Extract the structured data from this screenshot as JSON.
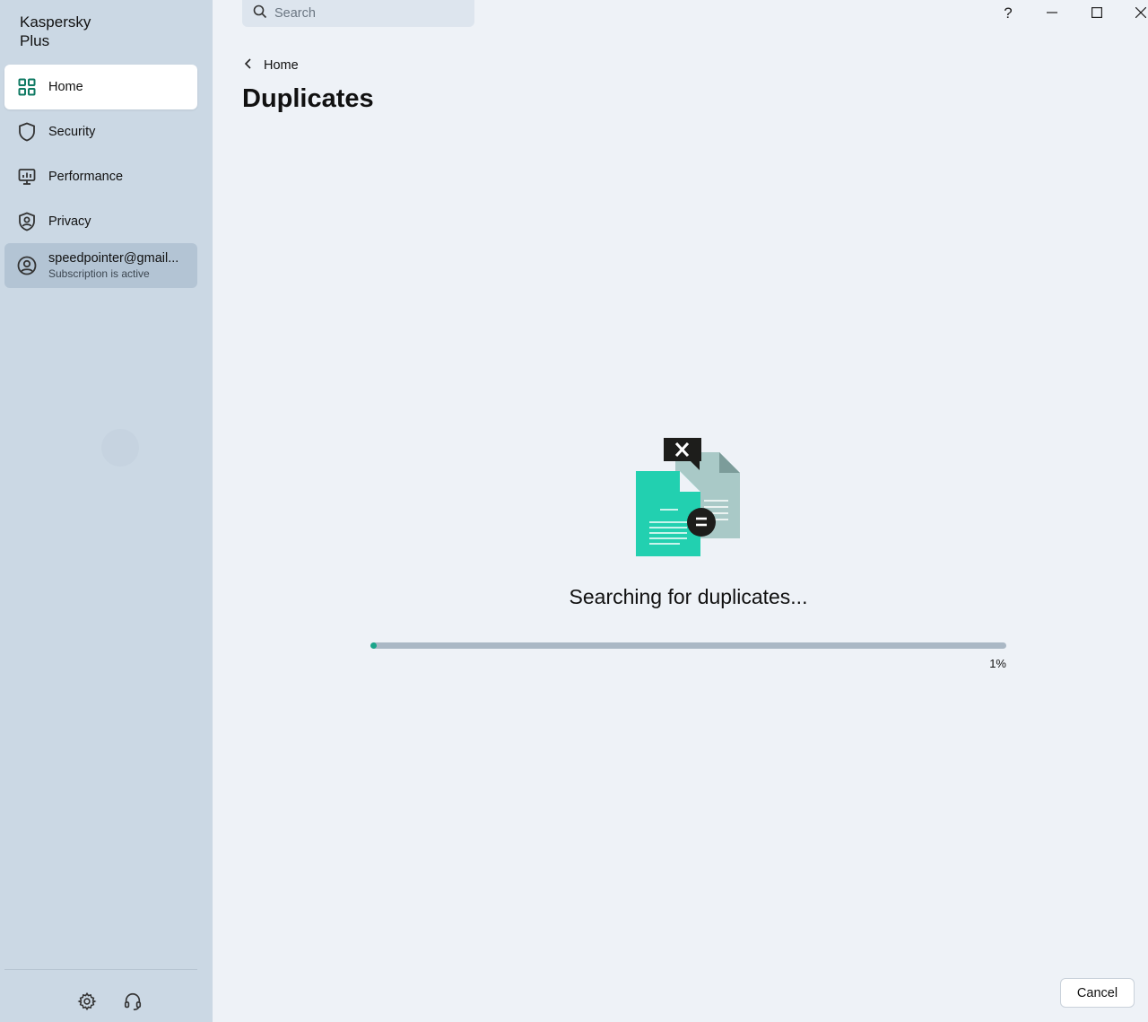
{
  "app": {
    "title_line1": "Kaspersky",
    "title_line2": "Plus"
  },
  "sidebar": {
    "items": [
      {
        "label": "Home",
        "icon": "dashboard-icon",
        "active": true
      },
      {
        "label": "Security",
        "icon": "shield-icon"
      },
      {
        "label": "Performance",
        "icon": "monitor-icon"
      },
      {
        "label": "Privacy",
        "icon": "privacy-shield-icon"
      }
    ],
    "account": {
      "email": "speedpointer@gmail...",
      "status": "Subscription is active",
      "icon": "user-circle-icon"
    },
    "footer": [
      {
        "icon": "gear-icon"
      },
      {
        "icon": "headset-icon"
      }
    ]
  },
  "search": {
    "placeholder": "Search"
  },
  "window_controls": {
    "help": "?"
  },
  "breadcrumb": {
    "label": "Home"
  },
  "page": {
    "title": "Duplicates"
  },
  "scan": {
    "status_text": "Searching for duplicates...",
    "progress": 1,
    "progress_label": "1%"
  },
  "actions": {
    "cancel_label": "Cancel"
  },
  "colors": {
    "accent": "#1aa58a",
    "doc_front": "#22d0b0",
    "doc_back": "#a9c9c7",
    "sidebar": "#cbd8e4",
    "background": "#eef2f7"
  }
}
